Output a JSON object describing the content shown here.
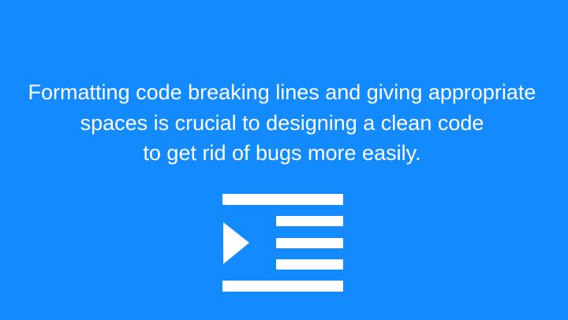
{
  "slide": {
    "background_color": "#148aff",
    "text_color": "#ffffff",
    "message_lines": [
      "Formatting code breaking lines and giving appropriate",
      "spaces is crucial to designing a clean code",
      "to get rid of bugs more easily."
    ],
    "icon": "indent-increase-icon"
  }
}
